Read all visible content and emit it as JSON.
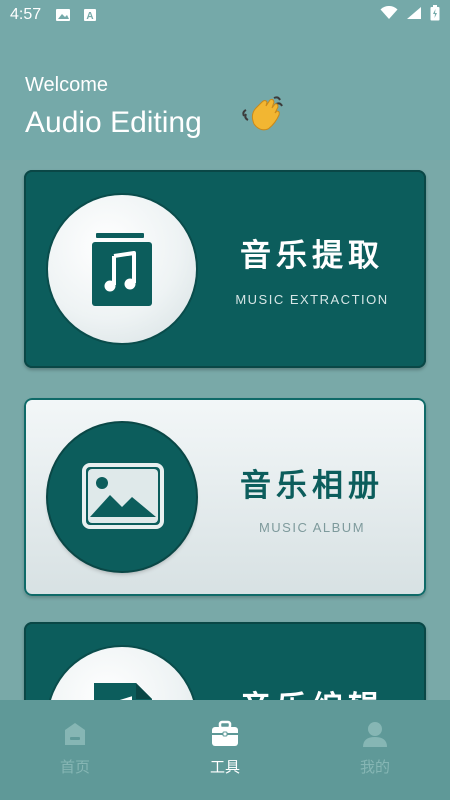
{
  "status_bar": {
    "time": "4:57",
    "icons": [
      "image-icon",
      "text-a-icon"
    ],
    "right_icons": [
      "wifi-icon",
      "signal-icon",
      "battery-icon"
    ]
  },
  "header": {
    "welcome": "Welcome",
    "title": "Audio Editing",
    "emoji": "waving-hand-icon"
  },
  "cards": [
    {
      "title": "音乐提取",
      "subtitle": "MUSIC EXTRACTION",
      "icon": "music-file-icon",
      "style": "dark"
    },
    {
      "title": "音乐相册",
      "subtitle": "MUSIC ALBUM",
      "icon": "image-icon",
      "style": "light"
    },
    {
      "title": "音乐编辑",
      "subtitle": "",
      "icon": "audio-file-icon",
      "style": "dark"
    }
  ],
  "tabbar": {
    "tabs": [
      {
        "label": "首页",
        "icon": "home-icon",
        "active": false
      },
      {
        "label": "工具",
        "icon": "toolbox-icon",
        "active": true
      },
      {
        "label": "我的",
        "icon": "user-icon",
        "active": false
      }
    ]
  },
  "colors": {
    "background": "#79a9a8",
    "card_dark": "#0c5d5c",
    "card_light": "#eef3f4",
    "tab_inactive": "#86b6b4",
    "tab_active": "#ffffff"
  }
}
